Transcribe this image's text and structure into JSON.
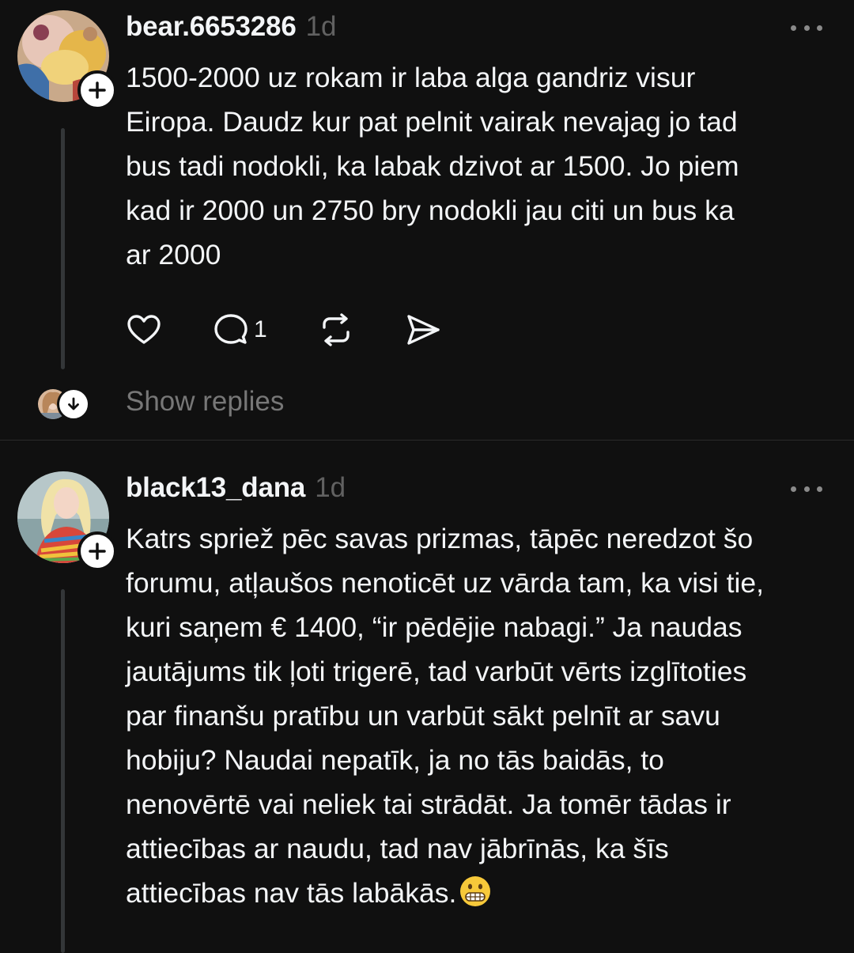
{
  "posts": [
    {
      "username": "bear.6653286",
      "time": "1d",
      "text": "1500-2000 uz rokam ir laba alga gandriz visur\nEiropa. Daudz kur pat pelnit vairak nevajag jo tad\nbus tadi nodokli, ka labak dzivot ar 1500. Jo piem\nkad ir 2000 un 2750 bry nodokli jau citi un bus ka\nar 2000",
      "reply_count": "1",
      "show_replies": "Show replies"
    },
    {
      "username": "black13_dana",
      "time": "1d",
      "text": "Katrs spriež pēc savas prizmas, tāpēc neredzot šo\nforumu, atļaušos nenoticēt uz vārda tam, ka visi tie,\nkuri saņem € 1400, “ir pēdējie nabagi.” Ja naudas\njautājums tik ļoti trigerē, tad varbūt vērts izglītoties\npar finanšu pratību un varbūt sākt pelnīt ar savu\nhobiju? Naudai nepatīk, ja no tās baidās, to\nnenovērtē vai neliek tai strādāt. Ja tomēr tādas ir\nattiecības ar naudu, tad nav jābrīnās, ka šīs\nattiecības nav tās labākās."
    }
  ],
  "icons": {
    "follow": "plus-icon",
    "more": "more-horizontal-icon",
    "like": "heart-icon",
    "reply": "comment-bubble-icon",
    "repost": "repost-icon",
    "share": "send-icon",
    "expand": "arrow-down-icon",
    "emoji": "grimacing-face-emoji"
  },
  "colors": {
    "background": "#101010",
    "primary_text": "#f3f5f7",
    "secondary_text": "#616161",
    "thread_line": "#333638"
  }
}
